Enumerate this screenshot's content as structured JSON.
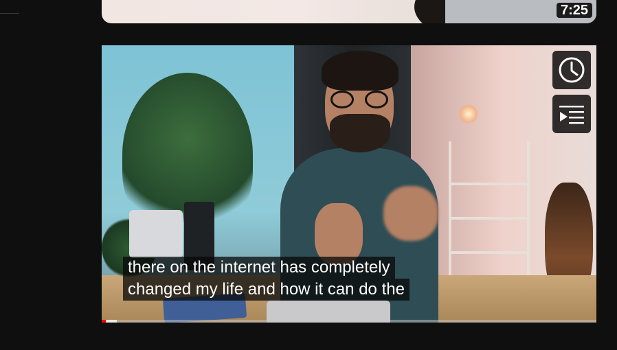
{
  "previous_video": {
    "duration": "7:25"
  },
  "video": {
    "captions": [
      "there on the internet has completely",
      "changed my life and how it can do the"
    ],
    "hover_buttons": {
      "watch_later_icon": "clock-icon",
      "add_to_queue_icon": "add-to-queue-icon"
    },
    "progress": {
      "played_fraction": 0.008,
      "buffered_fraction": 0.03
    }
  },
  "colors": {
    "background": "#0f0f0f",
    "progress_played": "#ff0000"
  }
}
